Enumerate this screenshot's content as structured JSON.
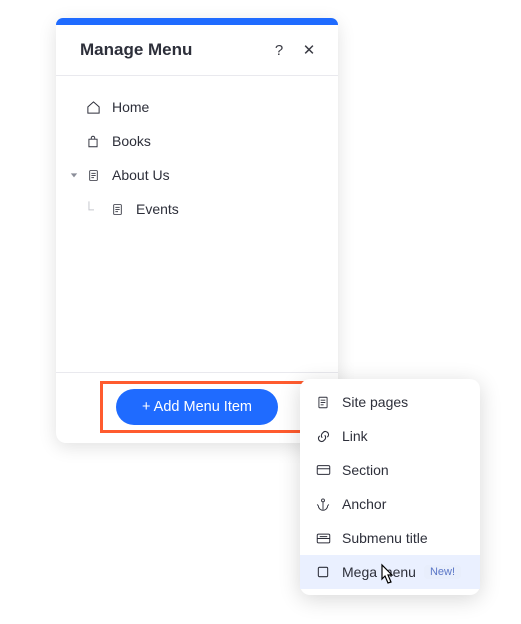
{
  "panel": {
    "title": "Manage Menu",
    "help": "?",
    "close": "✕"
  },
  "menu": {
    "items": [
      {
        "label": "Home"
      },
      {
        "label": "Books"
      },
      {
        "label": "About Us"
      },
      {
        "label": "Events"
      }
    ]
  },
  "footer": {
    "add_label": "+ Add Menu Item"
  },
  "dropdown": {
    "items": [
      {
        "label": "Site pages"
      },
      {
        "label": "Link"
      },
      {
        "label": "Section"
      },
      {
        "label": "Anchor"
      },
      {
        "label": "Submenu title"
      },
      {
        "label": "Mega menu",
        "badge": "New!"
      }
    ]
  }
}
